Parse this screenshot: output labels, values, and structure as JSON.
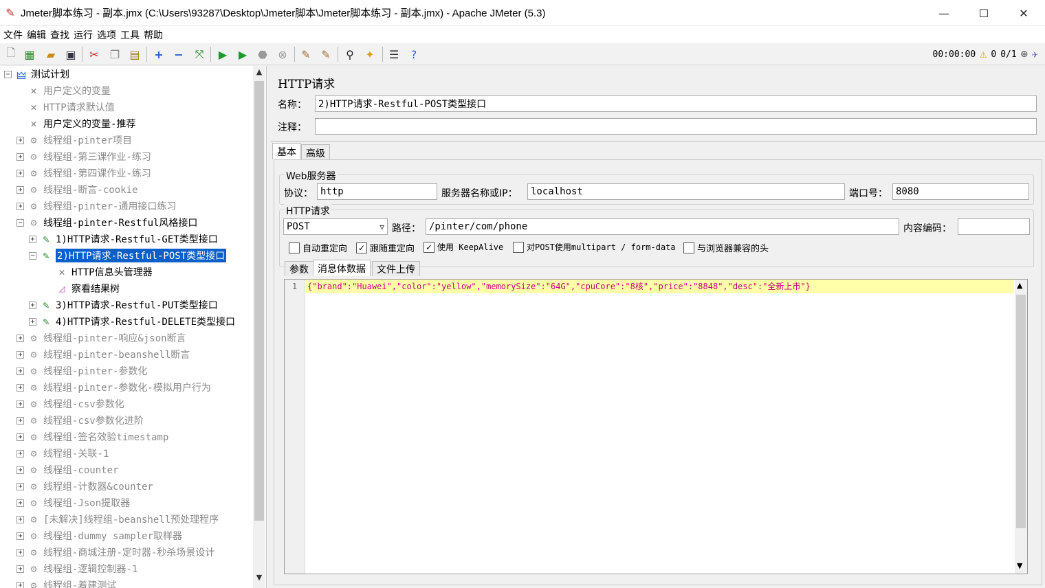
{
  "window": {
    "title": "Jmeter脚本练习 - 副本.jmx (C:\\Users\\93287\\Desktop\\Jmeter脚本\\Jmeter脚本练习 - 副本.jmx) - Apache JMeter (5.3)",
    "minimize": "—",
    "maximize": "☐",
    "close": "✕"
  },
  "menu": [
    "文件",
    "编辑",
    "查找",
    "运行",
    "选项",
    "工具",
    "帮助"
  ],
  "status": {
    "timer": "00:00:00",
    "warnings": "0",
    "threads": "0/1"
  },
  "tree": {
    "items": [
      {
        "label": "测试计划",
        "icon": "test-plan-icon",
        "depth": 0,
        "expander": "−",
        "style": "normal"
      },
      {
        "label": "用户定义的变量",
        "icon": "wrench-icon",
        "depth": 1,
        "expander": "",
        "style": "dim"
      },
      {
        "label": "HTTP请求默认值",
        "icon": "wrench-icon",
        "depth": 1,
        "expander": "",
        "style": "dim"
      },
      {
        "label": "用户定义的变量-推荐",
        "icon": "wrench-icon",
        "depth": 1,
        "expander": "",
        "style": "normal"
      },
      {
        "label": "线程组-pinter项目",
        "icon": "gear-icon",
        "depth": 1,
        "expander": "+",
        "style": "dim"
      },
      {
        "label": "线程组-第三课作业-练习",
        "icon": "gear-icon",
        "depth": 1,
        "expander": "+",
        "style": "dim"
      },
      {
        "label": "线程组-第四课作业-练习",
        "icon": "gear-icon",
        "depth": 1,
        "expander": "+",
        "style": "dim"
      },
      {
        "label": "线程组-断言-cookie",
        "icon": "gear-icon",
        "depth": 1,
        "expander": "+",
        "style": "dim"
      },
      {
        "label": "线程组-pinter-通用接口练习",
        "icon": "gear-icon",
        "depth": 1,
        "expander": "+",
        "style": "dim"
      },
      {
        "label": "线程组-pinter-Restful风格接口",
        "icon": "gear-icon",
        "depth": 1,
        "expander": "−",
        "style": "normal"
      },
      {
        "label": "1)HTTP请求-Restful-GET类型接口",
        "icon": "pipette-icon",
        "depth": 2,
        "expander": "+",
        "style": "normal"
      },
      {
        "label": "2)HTTP请求-Restful-POST类型接口",
        "icon": "pipette-icon",
        "depth": 2,
        "expander": "−",
        "style": "selected"
      },
      {
        "label": "HTTP信息头管理器",
        "icon": "wrench-icon",
        "depth": 3,
        "expander": "",
        "style": "normal"
      },
      {
        "label": "察看结果树",
        "icon": "chart-icon",
        "depth": 3,
        "expander": "",
        "style": "normal"
      },
      {
        "label": "3)HTTP请求-Restful-PUT类型接口",
        "icon": "pipette-icon",
        "depth": 2,
        "expander": "+",
        "style": "normal"
      },
      {
        "label": "4)HTTP请求-Restful-DELETE类型接口",
        "icon": "pipette-icon",
        "depth": 2,
        "expander": "+",
        "style": "normal"
      },
      {
        "label": "线程组-pinter-响应&json断言",
        "icon": "gear-icon",
        "depth": 1,
        "expander": "+",
        "style": "dim"
      },
      {
        "label": "线程组-pinter-beanshell断言",
        "icon": "gear-icon",
        "depth": 1,
        "expander": "+",
        "style": "dim"
      },
      {
        "label": "线程组-pinter-参数化",
        "icon": "gear-icon",
        "depth": 1,
        "expander": "+",
        "style": "dim"
      },
      {
        "label": "线程组-pinter-参数化-模拟用户行为",
        "icon": "gear-icon",
        "depth": 1,
        "expander": "+",
        "style": "dim"
      },
      {
        "label": "线程组-csv参数化",
        "icon": "gear-icon",
        "depth": 1,
        "expander": "+",
        "style": "dim"
      },
      {
        "label": "线程组-csv参数化进阶",
        "icon": "gear-icon",
        "depth": 1,
        "expander": "+",
        "style": "dim"
      },
      {
        "label": "线程组-签名效验timestamp",
        "icon": "gear-icon",
        "depth": 1,
        "expander": "+",
        "style": "dim"
      },
      {
        "label": "线程组-关联-1",
        "icon": "gear-icon",
        "depth": 1,
        "expander": "+",
        "style": "dim"
      },
      {
        "label": "线程组-counter",
        "icon": "gear-icon",
        "depth": 1,
        "expander": "+",
        "style": "dim"
      },
      {
        "label": "线程组-计数器&counter",
        "icon": "gear-icon",
        "depth": 1,
        "expander": "+",
        "style": "dim"
      },
      {
        "label": "线程组-Json提取器",
        "icon": "gear-icon",
        "depth": 1,
        "expander": "+",
        "style": "dim"
      },
      {
        "label": "[未解决]线程组-beanshell预处理程序",
        "icon": "gear-icon",
        "depth": 1,
        "expander": "+",
        "style": "dim"
      },
      {
        "label": "线程组-dummy sampler取样器",
        "icon": "gear-icon",
        "depth": 1,
        "expander": "+",
        "style": "dim"
      },
      {
        "label": "线程组-商城注册-定时器-秒杀场景设计",
        "icon": "gear-icon",
        "depth": 1,
        "expander": "+",
        "style": "dim"
      },
      {
        "label": "线程组-逻辑控制器-1",
        "icon": "gear-icon",
        "depth": 1,
        "expander": "+",
        "style": "dim"
      },
      {
        "label": "线程组-着建测试",
        "icon": "gear-icon",
        "depth": 1,
        "expander": "+",
        "style": "dim"
      }
    ]
  },
  "panel": {
    "heading": "HTTP请求",
    "name_label": "名称：",
    "name_value": "2)HTTP请求-Restful-POST类型接口",
    "comment_label": "注释：",
    "comment_value": "",
    "tabs": [
      "基本",
      "高级"
    ],
    "web_server": {
      "group_title": "Web服务器",
      "protocol_label": "协议：",
      "protocol_value": "http",
      "server_label": "服务器名称或IP：",
      "server_value": "localhost",
      "port_label": "端口号：",
      "port_value": "8080"
    },
    "http_request": {
      "group_title": "HTTP请求",
      "method": "POST",
      "path_label": "路径：",
      "path_value": "/pinter/com/phone",
      "encoding_label": "内容编码：",
      "encoding_value": ""
    },
    "checkboxes": [
      {
        "label": "自动重定向",
        "checked": false
      },
      {
        "label": "跟随重定向",
        "checked": true
      },
      {
        "label": "使用 KeepAlive",
        "checked": true
      },
      {
        "label": "对POST使用multipart / form-data",
        "checked": false
      },
      {
        "label": "与浏览器兼容的头",
        "checked": false
      }
    ],
    "sub_tabs": [
      "参数",
      "消息体数据",
      "文件上传"
    ],
    "body": {
      "line_number": "1",
      "content": "{\"brand\":\"Huawei\",\"color\":\"yellow\",\"memorySize\":\"64G\",\"cpuCore\":\"8核\",\"price\":\"8848\",\"desc\":\"全新上市\"}"
    }
  }
}
